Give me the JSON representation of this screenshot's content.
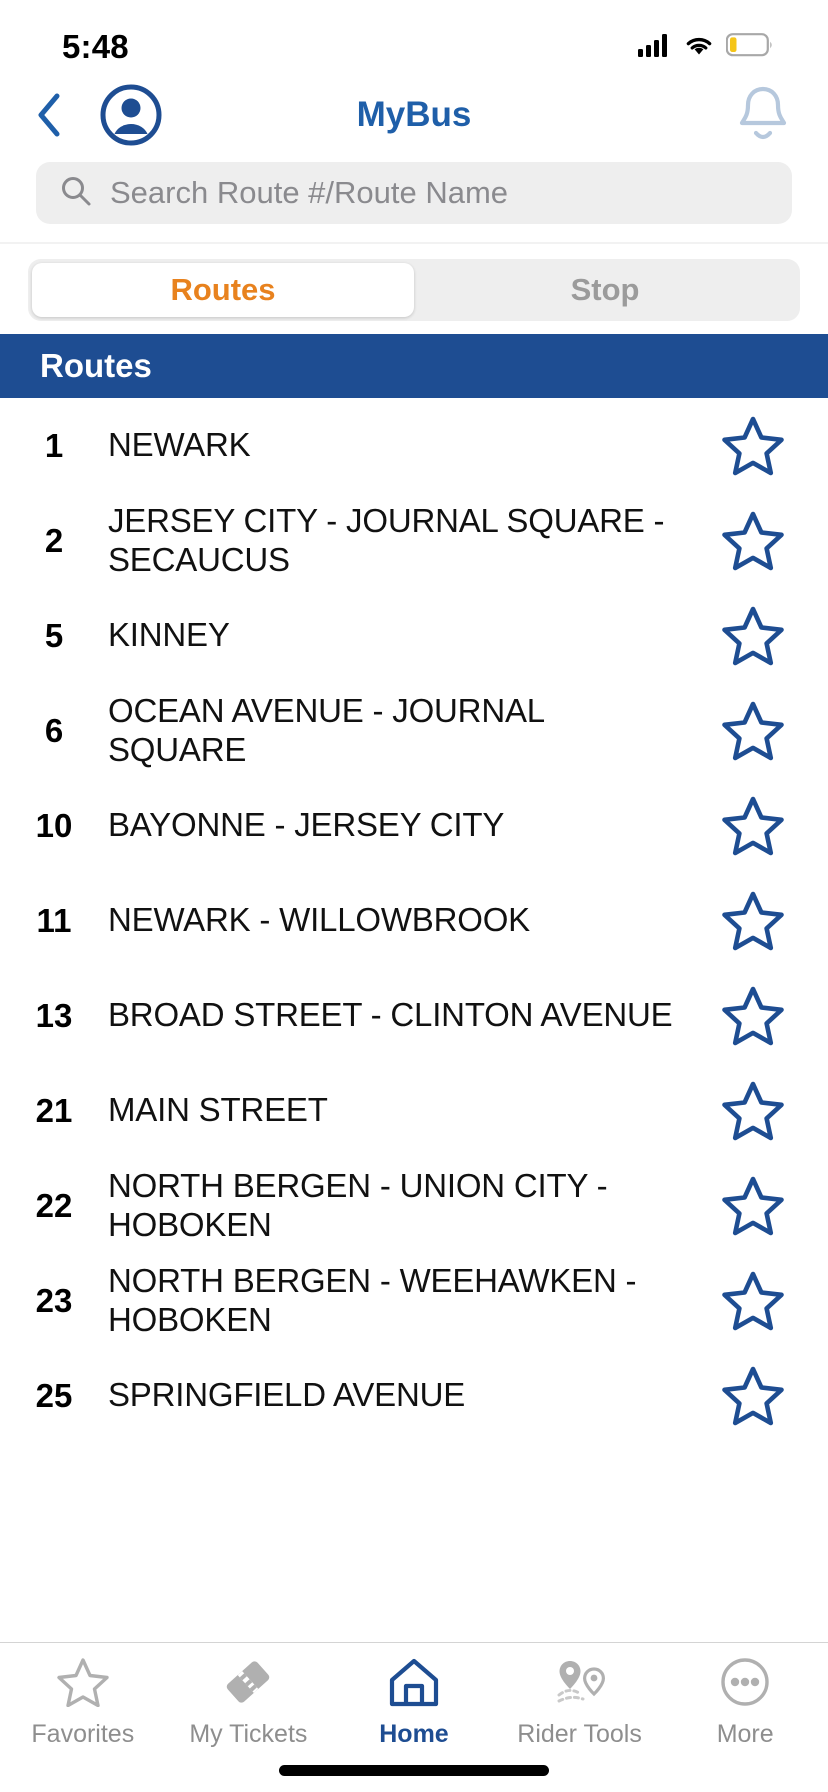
{
  "status_bar": {
    "time": "5:48",
    "signal_icon": "cellular-signal-icon",
    "wifi_icon": "wifi-icon",
    "battery_icon": "battery-low-icon"
  },
  "nav": {
    "back_icon": "chevron-left-icon",
    "avatar_icon": "user-avatar-icon",
    "title": "MyBus",
    "bell_icon": "notification-bell-icon"
  },
  "search": {
    "icon": "search-icon",
    "placeholder": "Search Route #/Route Name",
    "value": ""
  },
  "segmented": {
    "tabs": [
      {
        "label": "Routes",
        "active": true
      },
      {
        "label": "Stop",
        "active": false
      }
    ]
  },
  "section": {
    "header": "Routes"
  },
  "routes": [
    {
      "number": "1",
      "name": "NEWARK"
    },
    {
      "number": "2",
      "name": "JERSEY CITY - JOURNAL SQUARE - SECAUCUS"
    },
    {
      "number": "5",
      "name": "KINNEY"
    },
    {
      "number": "6",
      "name": "OCEAN AVENUE - JOURNAL SQUARE"
    },
    {
      "number": "10",
      "name": "BAYONNE - JERSEY CITY"
    },
    {
      "number": "11",
      "name": "NEWARK - WILLOWBROOK"
    },
    {
      "number": "13",
      "name": "BROAD STREET - CLINTON AVENUE"
    },
    {
      "number": "21",
      "name": "MAIN STREET"
    },
    {
      "number": "22",
      "name": "NORTH BERGEN - UNION CITY - HOBOKEN"
    },
    {
      "number": "23",
      "name": "NORTH BERGEN - WEEHAWKEN - HOBOKEN"
    },
    {
      "number": "25",
      "name": "SPRINGFIELD AVENUE"
    }
  ],
  "favorite_icon": "star-outline-icon",
  "tabbar": {
    "items": [
      {
        "label": "Favorites",
        "icon": "star-outline-icon",
        "active": false
      },
      {
        "label": "My Tickets",
        "icon": "ticket-icon",
        "active": false
      },
      {
        "label": "Home",
        "icon": "home-icon",
        "active": true
      },
      {
        "label": "Rider Tools",
        "icon": "map-pins-icon",
        "active": false
      },
      {
        "label": "More",
        "icon": "ellipsis-circle-icon",
        "active": false
      }
    ]
  },
  "colors": {
    "brand_blue": "#1e4d92",
    "title_blue": "#1f5fa9",
    "accent_orange": "#e8821e",
    "muted_gray": "#8e8e8e",
    "field_gray": "#eeeeee"
  }
}
